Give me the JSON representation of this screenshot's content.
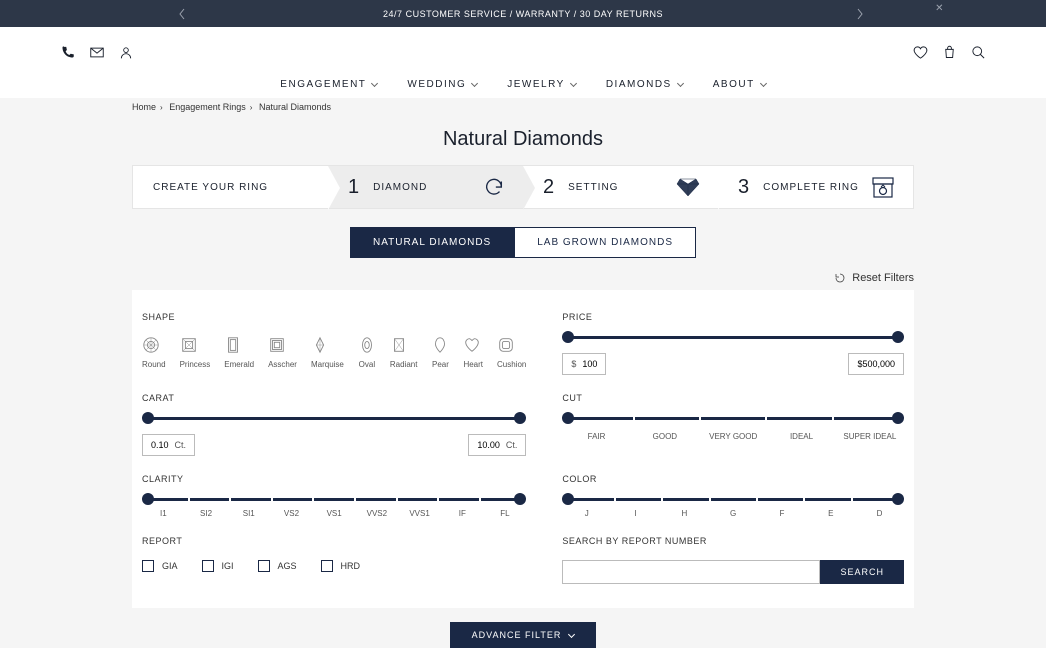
{
  "announcement": {
    "text": "24/7 CUSTOMER SERVICE / WARRANTY / 30 DAY RETURNS"
  },
  "nav": [
    "ENGAGEMENT",
    "WEDDING",
    "JEWELRY",
    "DIAMONDS",
    "ABOUT"
  ],
  "breadcrumb": [
    "Home",
    "Engagement Rings",
    "Natural Diamonds"
  ],
  "page_title": "Natural Diamonds",
  "steps": {
    "create": "CREATE YOUR RING",
    "items": [
      {
        "num": "1",
        "label": "DIAMOND"
      },
      {
        "num": "2",
        "label": "SETTING"
      },
      {
        "num": "3",
        "label": "COMPLETE RING"
      }
    ]
  },
  "tabs": {
    "active": "NATURAL DIAMONDS",
    "inactive": "LAB GROWN DIAMONDS"
  },
  "reset": "Reset Filters",
  "shape": {
    "label": "SHAPE",
    "items": [
      "Round",
      "Princess",
      "Emerald",
      "Asscher",
      "Marquise",
      "Oval",
      "Radiant",
      "Pear",
      "Heart",
      "Cushion"
    ]
  },
  "price": {
    "label": "PRICE",
    "currency": "$",
    "min": "100",
    "max": "$500,000"
  },
  "carat": {
    "label": "CARAT",
    "min": "0.10",
    "max": "10.00",
    "unit": "Ct."
  },
  "cut": {
    "label": "CUT",
    "ticks": [
      "FAIR",
      "GOOD",
      "VERY GOOD",
      "IDEAL",
      "SUPER IDEAL"
    ]
  },
  "clarity": {
    "label": "CLARITY",
    "ticks": [
      "I1",
      "SI2",
      "SI1",
      "VS2",
      "VS1",
      "VVS2",
      "VVS1",
      "IF",
      "FL"
    ]
  },
  "color": {
    "label": "COLOR",
    "ticks": [
      "J",
      "I",
      "H",
      "G",
      "F",
      "E",
      "D"
    ]
  },
  "report": {
    "label": "REPORT",
    "items": [
      "GIA",
      "IGI",
      "AGS",
      "HRD"
    ]
  },
  "searchrep": {
    "label": "SEARCH BY REPORT NUMBER",
    "btn": "SEARCH"
  },
  "advance": "ADVANCE FILTER"
}
